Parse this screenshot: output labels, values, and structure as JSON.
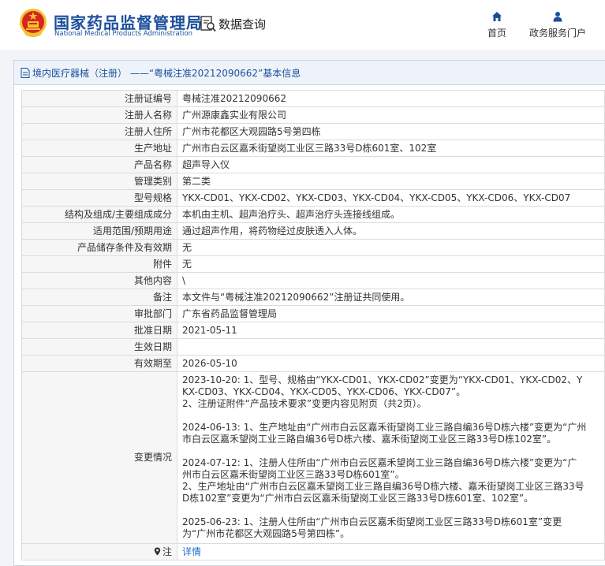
{
  "header": {
    "brand_cn": "国家药品监督管理局",
    "brand_en": "National Medical Products Administration",
    "query_label": "数据查询",
    "nav": {
      "home": "首页",
      "gov_service": "政务服务门户"
    }
  },
  "colors": {
    "brand_blue": "#1b4f9c",
    "link_blue": "#1b6fc2",
    "emblem_red": "#d7261e",
    "emblem_gold": "#f2c230"
  },
  "icons": {
    "emblem": "national-emblem-icon",
    "query": "magnifier-document-icon",
    "home": "home-icon",
    "gov": "user-icon",
    "title": "document-icon",
    "note": "map-pin-icon"
  },
  "panel": {
    "title": "境内医疗器械（注册） ——“粤械注准20212090662”基本信息"
  },
  "rows": [
    {
      "label": "注册证编号",
      "value": "粤械注准20212090662"
    },
    {
      "label": "注册人名称",
      "value": "广州源康鑫实业有限公司"
    },
    {
      "label": "注册人住所",
      "value": "广州市花都区大观园路5号第四栋"
    },
    {
      "label": "生产地址",
      "value": "广州市白云区嘉禾街望岗工业区三路33号D栋601室、102室"
    },
    {
      "label": "产品名称",
      "value": "超声导入仪"
    },
    {
      "label": "管理类别",
      "value": "第二类"
    },
    {
      "label": "型号规格",
      "value": "YKX-CD01、YKX-CD02、YKX-CD03、YKX-CD04、YKX-CD05、YKX-CD06、YKX-CD07"
    },
    {
      "label": "结构及组成/主要组成成分",
      "value": "本机由主机、超声治疗头、超声治疗头连接线组成。"
    },
    {
      "label": "适用范围/预期用途",
      "value": "通过超声作用，将药物经过皮肤透入人体。"
    },
    {
      "label": "产品储存条件及有效期",
      "value": "无"
    },
    {
      "label": "附件",
      "value": "无"
    },
    {
      "label": "其他内容",
      "value": "\\"
    },
    {
      "label": "备注",
      "value": "本文件与“粤械注准20212090662”注册证共同使用。"
    },
    {
      "label": "审批部门",
      "value": "广东省药品监督管理局"
    },
    {
      "label": "批准日期",
      "value": "2021-05-11"
    },
    {
      "label": "生效日期",
      "value": ""
    },
    {
      "label": "有效期至",
      "value": "2026-05-10"
    }
  ],
  "changes": {
    "label": "变更情况",
    "entries": [
      "2023-10-20: 1、型号、规格由“YKX-CD01、YKX-CD02”变更为“YKX-CD01、YKX-CD02、Y\nKX-CD03、YKX-CD04、YKX-CD05、YKX-CD06、YKX-CD07”。\n2、注册证附件“产品技术要求”变更内容见附页（共2页）。",
      "2024-06-13: 1、生产地址由“广州市白云区嘉禾街望岗工业三路自编36号D栋六楼”变更为“广州\n市白云区嘉禾望岗工业三路自编36号D栋六楼、嘉禾街望岗工业区三路33号D栋102室”。",
      "2024-07-12: 1、注册人住所由“广州市白云区嘉禾望岗工业三路自编36号D栋六楼”变更为“广\n州市白云区嘉禾街望岗工业区三路33号D栋601室”。\n2、生产地址由“广州市白云区嘉禾望岗工业三路自编36号D栋六楼、嘉禾街望岗工业区三路33号\nD栋102室”变更为“广州市白云区嘉禾街望岗工业区三路33号D栋601室、102室”。",
      "2025-06-23: 1、注册人住所由“广州市白云区嘉禾街望岗工业区三路33号D栋601室”变更\n为“广州市花都区大观园路5号第四栋”。"
    ]
  },
  "note": {
    "label": "注",
    "link": "详情"
  }
}
